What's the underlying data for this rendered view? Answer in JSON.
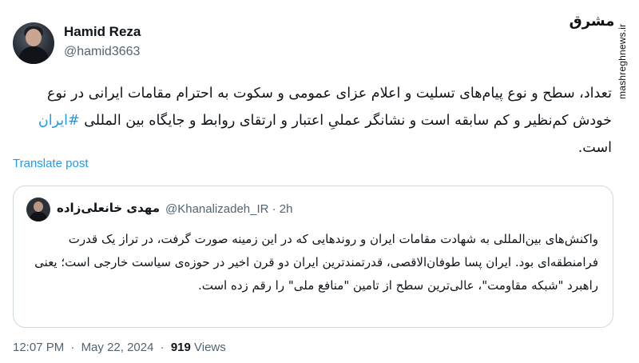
{
  "author": {
    "name": "Hamid Reza",
    "handle": "@hamid3663"
  },
  "watermark": {
    "logo": "مشرق",
    "site": "mashreghnews.ir"
  },
  "tweet": {
    "text_before_hashtag": "تعداد، سطح و نوع پیام‌های تسلیت و اعلام عزای عمومی و سکوت به احترام مقامات ایرانی در نوع خودش کم‌نظیر و کم سابقه است و نشانگر عملیِ اعتبار و ارتقای روابط و جایگاه بین المللی",
    "hashtag": "#ایران",
    "text_after_hashtag": "است.",
    "translate_label": "Translate post"
  },
  "quoted": {
    "name": "مهدی خانعلی‌زاده",
    "handle_time": "@Khanalizadeh_IR · 2h",
    "text": "واکنش‌های بین‌المللی به شهادت مقامات ایران و روندهایی که در این زمینه صورت گرفت، در تراز یک قدرت فرامنطقه‌ای بود. ایران پسا طوفان‌الاقصی، قدرتمندترین ایران دو قرن اخیر در حوزه‌ی سیاست خارجی است؛ یعنی راهبرد \"شبکه مقاومت\"، عالی‌ترین سطح از تامین \"منافع ملی\" را رقم زده است."
  },
  "meta": {
    "time": "12:07 PM",
    "date": "May 22, 2024",
    "views_count": "919",
    "views_label": "Views",
    "separator": "·"
  }
}
